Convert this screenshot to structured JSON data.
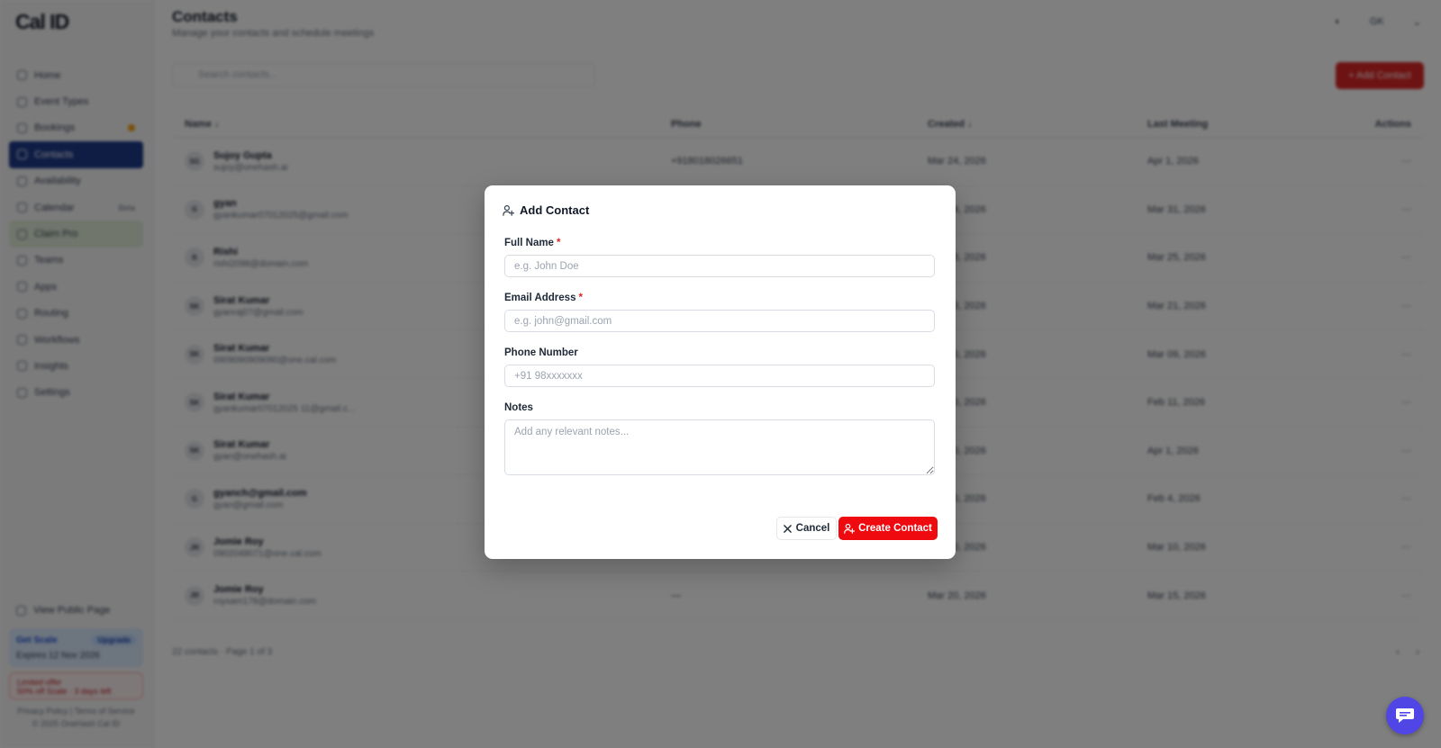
{
  "app": {
    "logo": "Cal ID",
    "nav": [
      {
        "label": "Home",
        "key": "home"
      },
      {
        "label": "Event Types",
        "key": "event-types"
      },
      {
        "label": "Bookings",
        "key": "bookings"
      },
      {
        "label": "Contacts",
        "key": "contacts"
      },
      {
        "label": "Availability",
        "key": "availability"
      },
      {
        "label": "Calendar",
        "key": "calendar"
      },
      {
        "label": "Claim Pro",
        "key": "claim-pro"
      },
      {
        "label": "Teams",
        "key": "teams"
      },
      {
        "label": "Apps",
        "key": "apps"
      },
      {
        "label": "Routing",
        "key": "routing"
      },
      {
        "label": "Workflows",
        "key": "workflows"
      },
      {
        "label": "Insights",
        "key": "insights"
      },
      {
        "label": "Settings",
        "key": "settings"
      }
    ],
    "calendar_badge": "Beta",
    "view_public_page": "View Public Page",
    "plan": {
      "name": "Get Scale",
      "pill": "Upgrade",
      "expires": "Expires 12 Nov 2026"
    },
    "promo": {
      "line1": "Limited offer",
      "line2": "50% off Scale · 3 days left"
    },
    "footer_line1": "Privacy Policy | Terms of Service",
    "footer_line2": "© 2025 OneHash Cal ID"
  },
  "page": {
    "title": "Contacts",
    "subtitle": "Manage your contacts and schedule meetings",
    "search_placeholder": "Search contacts...",
    "add_button": "+ Add Contact",
    "top_initials": "GK",
    "columns": {
      "name": "Name ↓",
      "phone": "Phone",
      "created": "Created ↓",
      "last_meeting": "Last Meeting",
      "actions": "Actions"
    },
    "rows": [
      {
        "initials": "SG",
        "name": "Sujoy Gupta",
        "email": "sujoy@onehash.ai",
        "phone": "+918018026651",
        "created": "Mar 24, 2026",
        "last": "Apr 1, 2026",
        "action": "···"
      },
      {
        "initials": "G",
        "name": "gyan",
        "email": "gyankumar07012025@gmail.com",
        "phone": "",
        "created": "Mar 24, 2026",
        "last": "Mar 31, 2026",
        "action": "···"
      },
      {
        "initials": "R",
        "name": "Rishi",
        "email": "rishi2098@domain.com",
        "phone": "",
        "created": "Mar 23, 2026",
        "last": "Mar 25, 2026",
        "action": "···"
      },
      {
        "initials": "SK",
        "name": "Sirat Kumar",
        "email": "gyanraj07@gmail.com",
        "phone": "",
        "created": "Mar 23, 2026",
        "last": "Mar 21, 2026",
        "action": "···"
      },
      {
        "initials": "SK",
        "name": "Sirat Kumar",
        "email": "0909090909090@one.cal.com",
        "phone": "",
        "created": "Mar 20, 2026",
        "last": "Mar 09, 2026",
        "action": "···"
      },
      {
        "initials": "SK",
        "name": "Sirat Kumar",
        "email": "gyankumar07012025 11@gmail.c...",
        "phone": "",
        "created": "Mar 20, 2026",
        "last": "Feb 11, 2026",
        "action": "···"
      },
      {
        "initials": "SK",
        "name": "Sirat Kumar",
        "email": "gyan@onehash.ai",
        "phone": "",
        "created": "Mar 20, 2026",
        "last": "Apr 1, 2026",
        "action": "···"
      },
      {
        "initials": "G",
        "name": "gyanch@gmail.com",
        "email": "gyan@gmail.com",
        "phone": "",
        "created": "Mar 20, 2026",
        "last": "Feb 4, 2026",
        "action": "···"
      },
      {
        "initials": "JR",
        "name": "Jomie Roy",
        "email": "0902048071@one.cal.com",
        "phone": "",
        "created": "Mar 20, 2026",
        "last": "Mar 10, 2026",
        "action": "···"
      },
      {
        "initials": "JR",
        "name": "Jomie Roy",
        "email": "roysam178@domain.com",
        "phone": "—",
        "created": "Mar 20, 2026",
        "last": "Mar 15, 2026",
        "action": "···"
      }
    ],
    "table_footer": "22 contacts · Page 1 of 3",
    "pager_prev": "‹",
    "pager_next": "›"
  },
  "modal": {
    "title": "Add Contact",
    "full_name_label": "Full Name",
    "full_name_placeholder": "e.g. John Doe",
    "email_label": "Email Address",
    "email_placeholder": "e.g. john@gmail.com",
    "phone_label": "Phone Number",
    "phone_placeholder": "+91 98xxxxxxx",
    "notes_label": "Notes",
    "notes_placeholder": "Add any relevant notes...",
    "required_marker": "*",
    "cancel_label": "Cancel",
    "create_label": "Create Contact"
  },
  "colors": {
    "primary_red": "#ee0a0f",
    "nav_active": "#1e3a8a",
    "chat_button": "#4f46e5"
  }
}
